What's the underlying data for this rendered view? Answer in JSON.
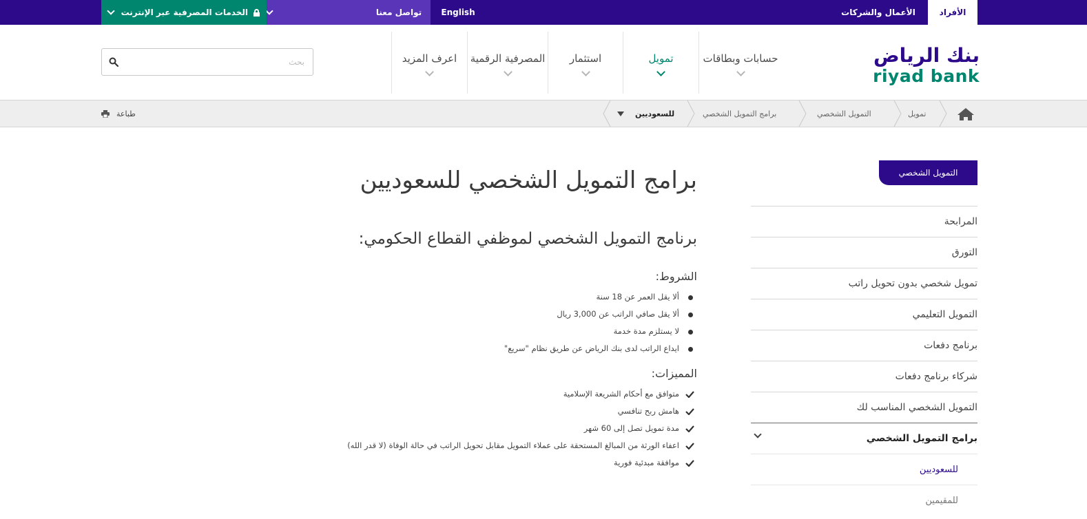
{
  "topbar": {
    "individuals": "الأفراد",
    "business": "الأعمال والشركات",
    "english": "English",
    "contact": "تواصل معنا",
    "online_banking": "الخدمات المصرفية عبر الإنترنت"
  },
  "logo": {
    "arabic": "بنك الرياض",
    "english": "riyad bank"
  },
  "nav": {
    "items": [
      {
        "label": "حسابات وبطاقات"
      },
      {
        "label": "تمويل"
      },
      {
        "label": "استثمار"
      },
      {
        "label": "المصرفية الرقمية"
      },
      {
        "label": "اعرف المزيد"
      }
    ]
  },
  "search": {
    "placeholder": "بحث"
  },
  "breadcrumb": {
    "items": [
      "تمويل",
      "التمويل الشخصي",
      "برامج التمويل الشخصي",
      "للسعوديين"
    ],
    "print": "طباعة"
  },
  "sidebar": {
    "heading": "التمويل الشخصي",
    "items": [
      "المرابحة",
      "التورق",
      "تمويل شخصي بدون تحويل راتب",
      "التمويل التعليمي",
      "برنامج دفعات",
      "شركاء برنامج دفعات",
      "التمويل الشخصي المناسب لك",
      "برامج التمويل الشخصي"
    ],
    "subitems": [
      "للسعوديين",
      "للمقيمين"
    ]
  },
  "content": {
    "title": "برامج التمويل الشخصي للسعوديين",
    "subtitle": "برنامج التمويل الشخصي لموظفي القطاع الحكومي:",
    "conditions_heading": "الشروط:",
    "conditions": [
      "ألا يقل العمر عن 18 سنة",
      "ألا يقل صافي الراتب عن 3,000 ريال",
      "لا يستلزم مدة خدمة",
      "ايداع الراتب لدى بنك الرياض عن طريق نظام \"سريع\""
    ],
    "features_heading": "المميزات:",
    "features": [
      "متوافق مع أحكام الشريعة الإسلامية",
      "هامش ربح تنافسي",
      "مدة تمويل تصل إلى 60 شهر",
      "اعفاء الورثة من المبالغ المستحقة على عملاء التمويل مقابل تحويل الراتب في حالة الوفاة (لا قدر الله)",
      "موافقة مبدئية فورية"
    ]
  },
  "colors": {
    "brand_purple": "#2c0a8a",
    "brand_green": "#00856f",
    "light_purple": "#5a35b8"
  }
}
